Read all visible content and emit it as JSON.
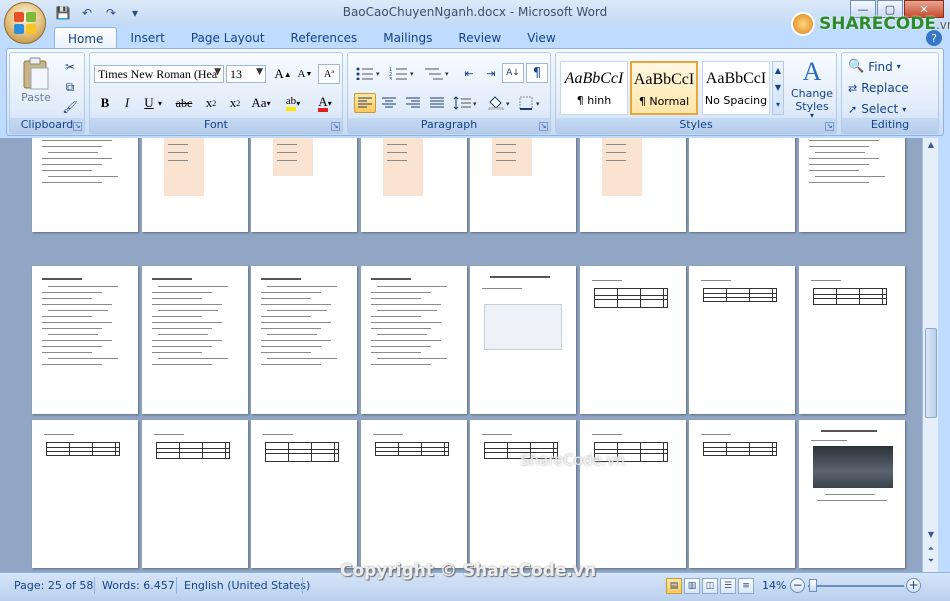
{
  "window": {
    "title": "BaoCaoChuyenNganh.docx - Microsoft Word",
    "controls": {
      "minimize": "—",
      "maximize": "▢",
      "close": "✕"
    }
  },
  "watermark": {
    "brand": "SHARECODE",
    "tld": ".vn",
    "middle": "ShareCode.vn",
    "copyright": "Copyright © ShareCode.vn"
  },
  "tabs": [
    "Home",
    "Insert",
    "Page Layout",
    "References",
    "Mailings",
    "Review",
    "View"
  ],
  "active_tab": "Home",
  "ribbon": {
    "clipboard": {
      "label": "Clipboard",
      "paste": "Paste"
    },
    "font": {
      "label": "Font",
      "font_name": "Times New Roman (Hea",
      "font_size": "13"
    },
    "paragraph": {
      "label": "Paragraph"
    },
    "styles": {
      "label": "Styles",
      "items": [
        {
          "sample": "AaBbCcI",
          "name": "¶ hinh"
        },
        {
          "sample": "AaBbCcI",
          "name": "¶ Normal"
        },
        {
          "sample": "AaBbCcI",
          "name": "No Spacing"
        }
      ],
      "change_styles": "Change Styles"
    },
    "editing": {
      "label": "Editing",
      "find": "Find",
      "replace": "Replace",
      "select": "Select"
    }
  },
  "status": {
    "page": "Page: 25 of 58",
    "words": "Words: 6.457",
    "language": "English (United States)",
    "zoom": "14%"
  },
  "colors": {
    "accent": "#15428b",
    "highlight": "#ffe600",
    "font_color": "#e02020",
    "ribbon_bg": "#dfeaf8"
  }
}
